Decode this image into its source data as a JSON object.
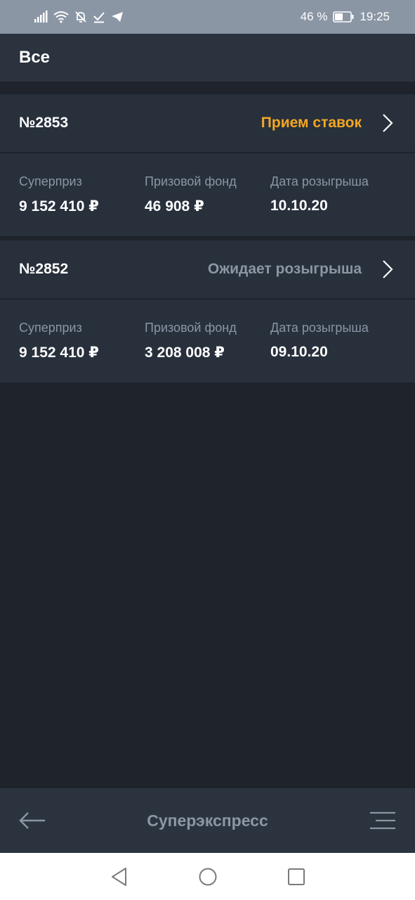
{
  "status_bar": {
    "battery": "46 %",
    "time": "19:25"
  },
  "header": {
    "title": "Все"
  },
  "draws": [
    {
      "number": "№2853",
      "status": "Прием ставок",
      "status_color": "#f5a623",
      "superprize_label": "Суперприз",
      "superprize": "9 152 410 ₽",
      "fund_label": "Призовой фонд",
      "fund": "46 908 ₽",
      "date_label": "Дата розыгрыша",
      "date": "10.10.20"
    },
    {
      "number": "№2852",
      "status": "Ожидает розыгрыша",
      "status_color": "#8b96a5",
      "superprize_label": "Суперприз",
      "superprize": "9 152 410 ₽",
      "fund_label": "Призовой фонд",
      "fund": "3 208 008 ₽",
      "date_label": "Дата розыгрыша",
      "date": "09.10.20"
    }
  ],
  "bottom_bar": {
    "title": "Суперэкспресс",
    "back_icon": "arrow-left-icon",
    "menu_icon": "menu-icon"
  },
  "colors": {
    "accent": "#f5a623",
    "muted": "#8b96a5",
    "background": "#1e232c",
    "card": "#27303b"
  }
}
